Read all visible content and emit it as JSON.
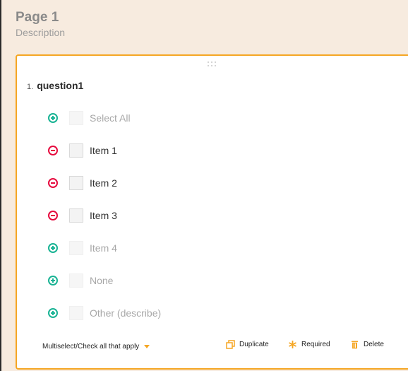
{
  "page": {
    "title": "Page 1",
    "description": "Description"
  },
  "question": {
    "number": "1.",
    "name": "question1",
    "choices": [
      {
        "label": "Select All",
        "state": "special",
        "action": "add"
      },
      {
        "label": "Item 1",
        "state": "active",
        "action": "remove"
      },
      {
        "label": "Item 2",
        "state": "active",
        "action": "remove"
      },
      {
        "label": "Item 3",
        "state": "active",
        "action": "remove"
      },
      {
        "label": "Item 4",
        "state": "special",
        "action": "add"
      },
      {
        "label": "None",
        "state": "special",
        "action": "add"
      },
      {
        "label": "Other (describe)",
        "state": "special",
        "action": "add"
      }
    ]
  },
  "footer": {
    "type_label": "Multiselect/Check all that apply",
    "duplicate_label": "Duplicate",
    "required_label": "Required",
    "delete_label": "Delete"
  },
  "icons": {
    "add": "plus-circle-icon",
    "remove": "minus-circle-icon",
    "duplicate": "duplicate-icon",
    "required": "asterisk-icon",
    "delete": "trash-icon"
  },
  "colors": {
    "accent": "#f5a623",
    "add": "#19b394",
    "remove": "#e60a3e",
    "page_background": "#f7ebdf"
  }
}
